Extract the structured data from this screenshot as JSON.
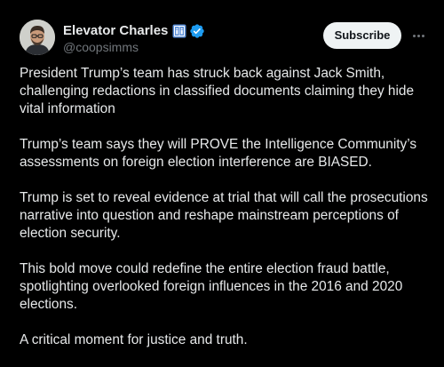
{
  "author": {
    "display_name": "Elevator Charles",
    "handle": "@coopsimms",
    "badge_icon": "elevator-icon",
    "verified_icon": "verified-badge-icon",
    "verified_color": "#1d9bf0",
    "badge_color": "#5b8fd8"
  },
  "actions": {
    "subscribe_label": "Subscribe",
    "more_icon": "more-horizontal-icon"
  },
  "tweet": {
    "paragraphs": [
      "President Trump’s team has struck back against Jack Smith, challenging redactions in classified documents claiming they hide vital information",
      "Trump’s team says they will PROVE the Intelligence Community’s assessments on foreign election interference are BIASED.",
      "Trump is set to reveal evidence at trial that will call the prosecutions narrative into question and reshape mainstream perceptions of election security.",
      "This bold move could redefine the entire election fraud battle, spotlighting overlooked foreign influences in the 2016 and 2020 elections.",
      "A critical moment for justice and truth."
    ]
  },
  "colors": {
    "background": "#000000",
    "text_primary": "#e7e9ea",
    "text_secondary": "#71767b",
    "button_bg": "#eff3f4",
    "button_text": "#0f1419"
  }
}
